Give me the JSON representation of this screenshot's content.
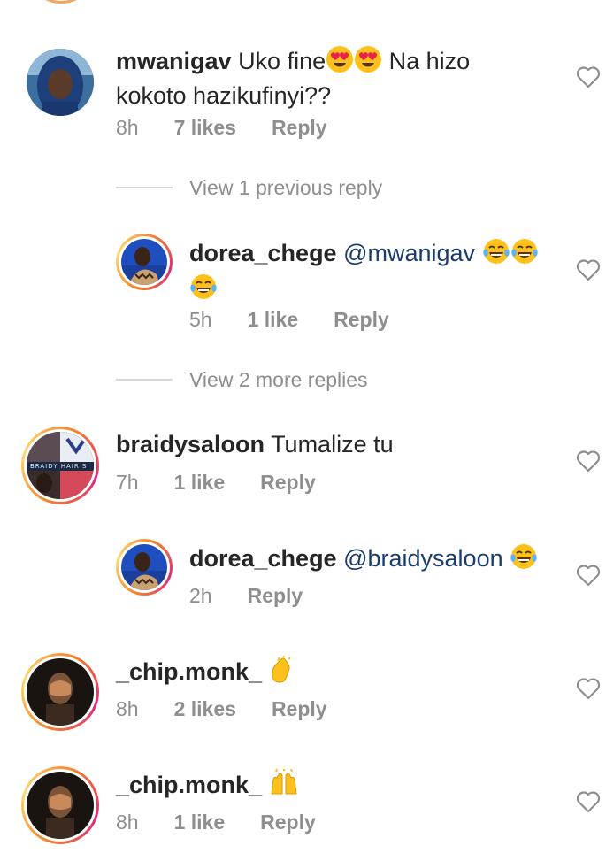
{
  "comments": [
    {
      "username": "mwanigav",
      "text_line1": "Uko fine",
      "text_line1b": "Na hizo",
      "text_line2": "kokoto hazikufinyi??",
      "time": "8h",
      "likes": "7 likes",
      "reply": "Reply",
      "emoji": [
        "heart-eyes",
        "heart-eyes"
      ]
    },
    {
      "username": "dorea_chege",
      "mention": "@mwanigav",
      "time": "5h",
      "likes": "1 like",
      "reply": "Reply",
      "emoji": [
        "tears-of-joy",
        "tears-of-joy",
        "tears-of-joy"
      ]
    },
    {
      "username": "braidysaloon",
      "text": "Tumalize tu",
      "time": "7h",
      "likes": "1 like",
      "reply": "Reply"
    },
    {
      "username": "dorea_chege",
      "mention": "@braidysaloon",
      "time": "2h",
      "reply": "Reply",
      "emoji": [
        "tears-of-joy"
      ]
    },
    {
      "username": "_chip.monk_",
      "time": "8h",
      "likes": "2 likes",
      "reply": "Reply",
      "emoji": [
        "clapping-hand"
      ]
    },
    {
      "username": "_chip.monk_",
      "time": "8h",
      "likes": "1 like",
      "reply": "Reply",
      "emoji": [
        "raising-hands"
      ]
    }
  ],
  "view_replies": {
    "previous": "View 1 previous reply",
    "more": "View 2 more replies"
  },
  "avatar_text": {
    "braidy_logo": "BRAIDY HAIR S"
  },
  "colors": {
    "text": "#262626",
    "meta": "#8e8e8e",
    "mention": "#1a3c6e",
    "story_ring_orange": "#f58529",
    "story_ring_pink": "#dd2a7b"
  }
}
